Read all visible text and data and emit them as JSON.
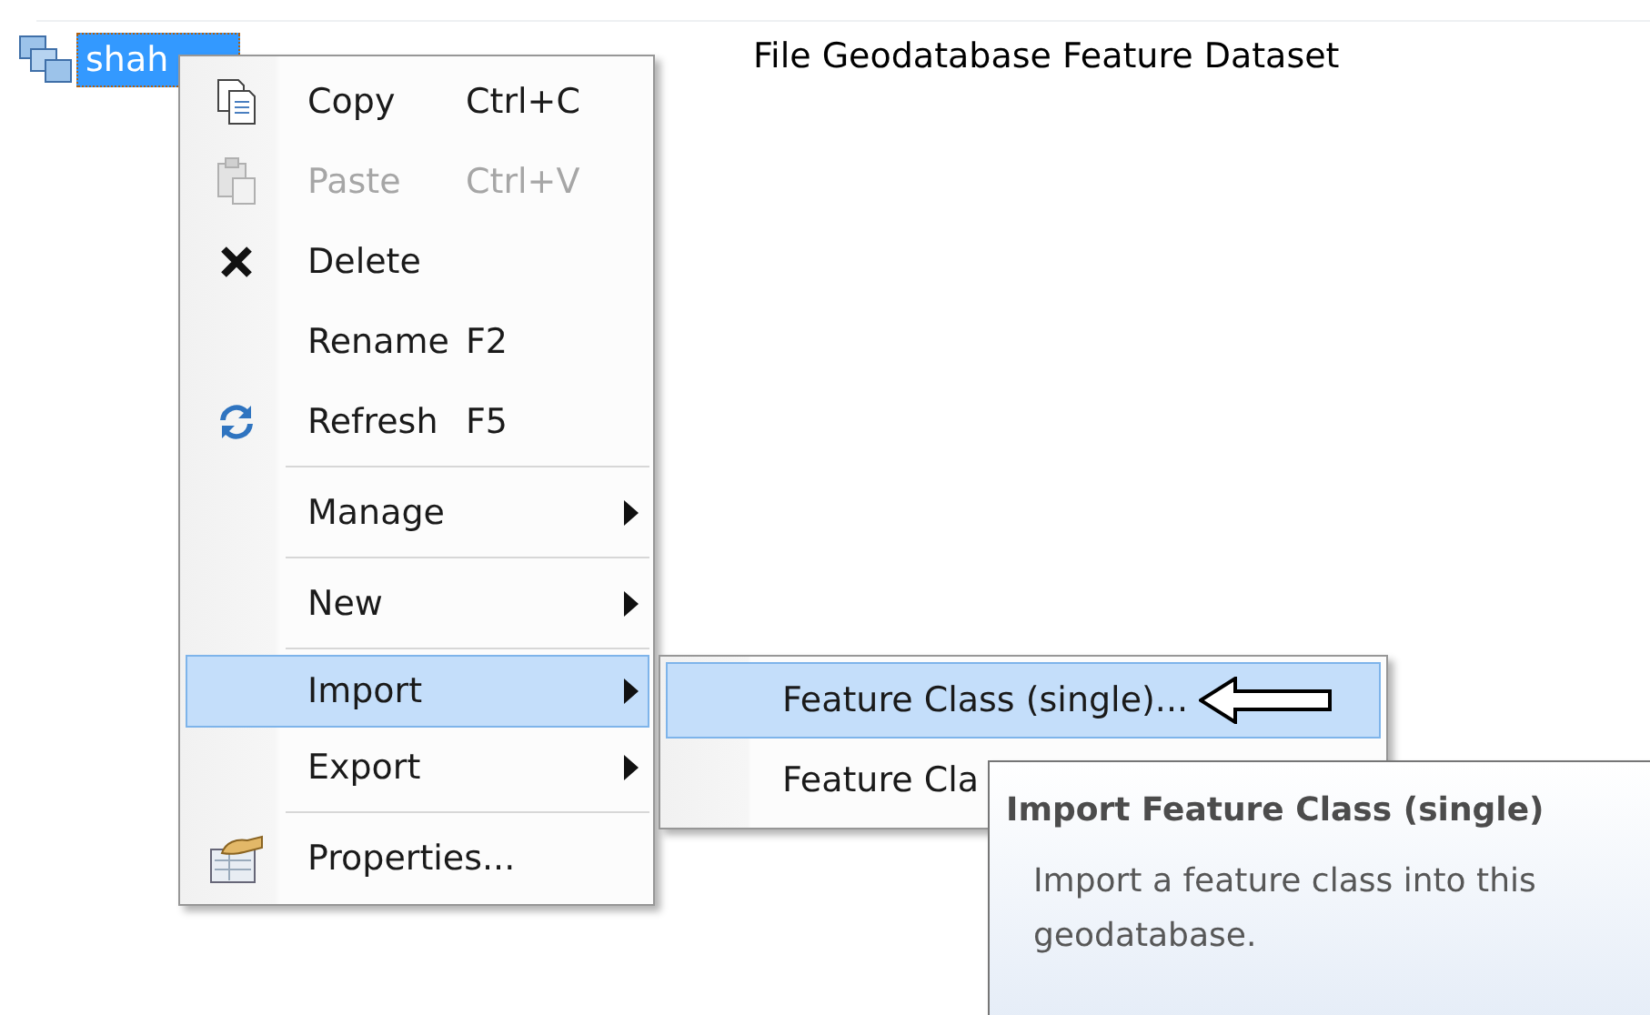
{
  "tree_item": {
    "label": "shah",
    "selected": true
  },
  "type_column": {
    "text": "File Geodatabase Feature Dataset"
  },
  "context_menu": {
    "groups": [
      [
        {
          "label": "Copy",
          "shortcut": "Ctrl+C",
          "disabled": false,
          "selected": false,
          "submenu": false
        },
        {
          "label": "Paste",
          "shortcut": "Ctrl+V",
          "disabled": true,
          "selected": false,
          "submenu": false
        },
        {
          "label": "Delete",
          "disabled": false,
          "selected": false,
          "submenu": false
        },
        {
          "label": "Rename",
          "shortcut": "F2",
          "disabled": false,
          "selected": false,
          "submenu": false
        },
        {
          "label": "Refresh",
          "shortcut": "F5",
          "disabled": false,
          "selected": false,
          "submenu": false
        }
      ],
      [
        {
          "label": "Manage",
          "disabled": false,
          "selected": false,
          "submenu": true
        }
      ],
      [
        {
          "label": "New",
          "disabled": false,
          "selected": false,
          "submenu": true
        }
      ],
      [
        {
          "label": "Import",
          "disabled": false,
          "selected": true,
          "submenu": true
        },
        {
          "label": "Export",
          "disabled": false,
          "selected": false,
          "submenu": true
        }
      ],
      [
        {
          "label": "Properties...",
          "disabled": false,
          "selected": false,
          "submenu": false
        }
      ]
    ]
  },
  "submenu": {
    "items": [
      {
        "label": "Feature Class (single)...",
        "selected": true,
        "pointer_arrow": true
      },
      {
        "label": "Feature Cla",
        "selected": false,
        "pointer_arrow": false
      }
    ]
  },
  "tooltip": {
    "title": "Import Feature Class (single)",
    "body": "Import a feature class into this geodatabase."
  }
}
